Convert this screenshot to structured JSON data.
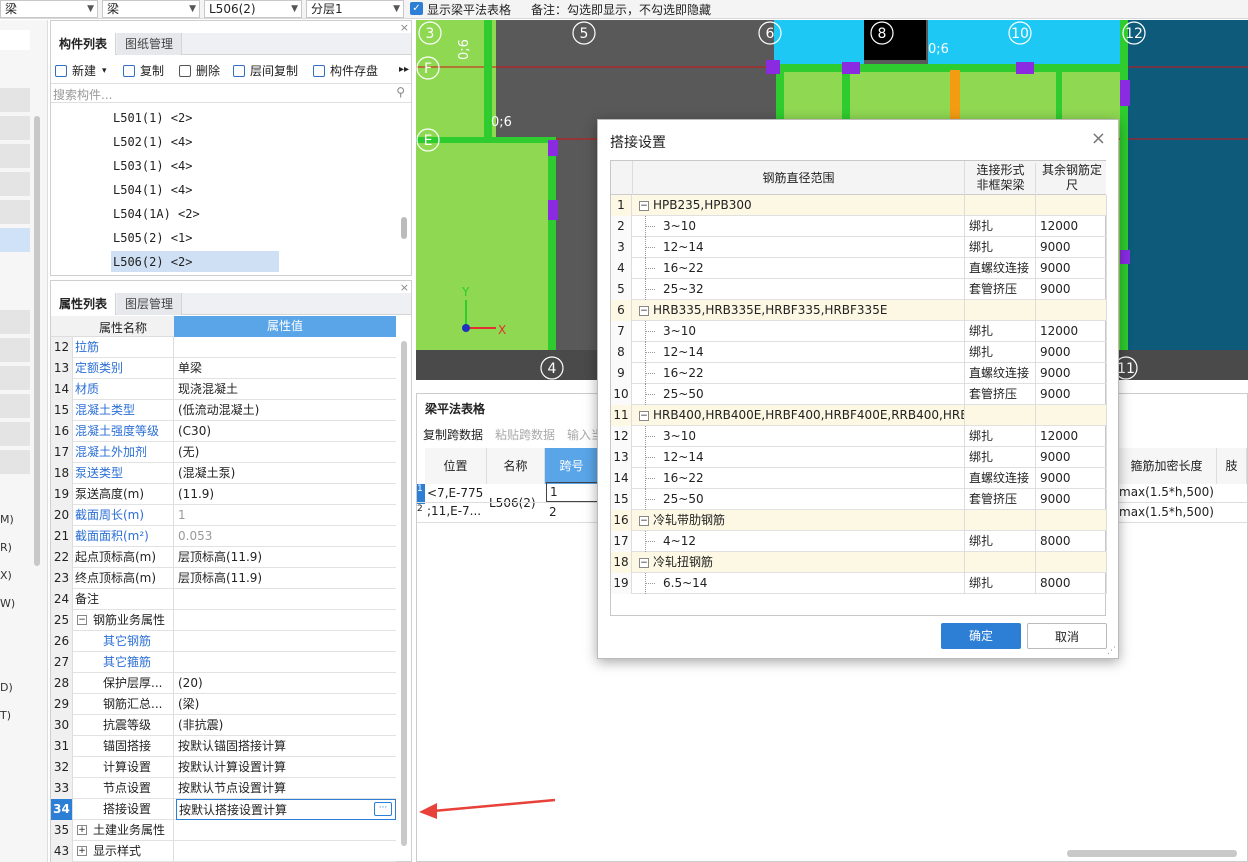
{
  "topbar": {
    "combo1": "梁",
    "combo2": "梁",
    "combo3": "L506(2)",
    "combo4": "分层1",
    "checkbox_label": "显示梁平法表格",
    "note": "备注：勾选即显示，不勾选即隐藏"
  },
  "left_strip": {
    "labels": [
      "M)",
      "R)",
      "X)",
      "W)",
      "D)",
      "T)"
    ]
  },
  "component_panel": {
    "tabs": [
      "构件列表",
      "图纸管理"
    ],
    "toolbar": [
      "新建",
      "复制",
      "删除",
      "层间复制",
      "构件存盘"
    ],
    "search_placeholder": "搜索构件...",
    "items": [
      "L501(1) <2>",
      "L502(1) <4>",
      "L503(1) <4>",
      "L504(1) <4>",
      "L504(1A) <2>",
      "L505(2) <1>",
      "L506(2) <2>"
    ],
    "selected_index": 6
  },
  "property_panel": {
    "tabs": [
      "属性列表",
      "图层管理"
    ],
    "headers": [
      "属性名称",
      "属性值"
    ],
    "rows": [
      {
        "num": "12",
        "name": "拉筋",
        "value": "",
        "style": "blue"
      },
      {
        "num": "13",
        "name": "定额类别",
        "value": "单梁",
        "style": "blue"
      },
      {
        "num": "14",
        "name": "材质",
        "value": "现浇混凝土",
        "style": "blue"
      },
      {
        "num": "15",
        "name": "混凝土类型",
        "value": "(低流动混凝土)",
        "style": "blue"
      },
      {
        "num": "16",
        "name": "混凝土强度等级",
        "value": "(C30)",
        "style": "blue"
      },
      {
        "num": "17",
        "name": "混凝土外加剂",
        "value": "(无)",
        "style": "blue"
      },
      {
        "num": "18",
        "name": "泵送类型",
        "value": "(混凝土泵)",
        "style": "blue"
      },
      {
        "num": "19",
        "name": "泵送高度(m)",
        "value": "(11.9)",
        "style": ""
      },
      {
        "num": "20",
        "name": "截面周长(m)",
        "value": "1",
        "style": "blue",
        "vstyle": "gray"
      },
      {
        "num": "21",
        "name": "截面面积(m²)",
        "value": "0.053",
        "style": "blue",
        "vstyle": "gray"
      },
      {
        "num": "22",
        "name": "起点顶标高(m)",
        "value": "层顶标高(11.9)",
        "style": ""
      },
      {
        "num": "23",
        "name": "终点顶标高(m)",
        "value": "层顶标高(11.9)",
        "style": ""
      },
      {
        "num": "24",
        "name": "备注",
        "value": "",
        "style": ""
      },
      {
        "num": "25",
        "name": "钢筋业务属性",
        "value": "",
        "style": "",
        "expand": "−"
      },
      {
        "num": "26",
        "name": "其它钢筋",
        "value": "",
        "style": "blue",
        "indent": true
      },
      {
        "num": "27",
        "name": "其它箍筋",
        "value": "",
        "style": "blue",
        "indent": true
      },
      {
        "num": "28",
        "name": "保护层厚...",
        "value": "(20)",
        "style": "",
        "indent": true
      },
      {
        "num": "29",
        "name": "钢筋汇总...",
        "value": "(梁)",
        "style": "",
        "indent": true
      },
      {
        "num": "30",
        "name": "抗震等级",
        "value": "(非抗震)",
        "style": "",
        "indent": true
      },
      {
        "num": "31",
        "name": "锚固搭接",
        "value": "按默认锚固搭接计算",
        "style": "",
        "indent": true
      },
      {
        "num": "32",
        "name": "计算设置",
        "value": "按默认计算设置计算",
        "style": "",
        "indent": true
      },
      {
        "num": "33",
        "name": "节点设置",
        "value": "按默认节点设置计算",
        "style": "",
        "indent": true
      },
      {
        "num": "34",
        "name": "搭接设置",
        "value": "按默认搭接设置计算",
        "style": "",
        "indent": true,
        "selected": true
      },
      {
        "num": "35",
        "name": "土建业务属性",
        "value": "",
        "style": "",
        "expand": "+"
      },
      {
        "num": "43",
        "name": "显示样式",
        "value": "",
        "style": "",
        "expand": "+"
      }
    ],
    "ellipsis": "···"
  },
  "canvas": {
    "grid_labels": [
      "3",
      "5",
      "6",
      "8",
      "10",
      "12"
    ],
    "row_labels": [
      "F",
      "E"
    ],
    "dims": [
      "0;6",
      "0;6",
      "0;6"
    ],
    "axis_x": "X",
    "axis_y": "Y",
    "bottom_labels": [
      "4",
      "11"
    ]
  },
  "dialog": {
    "title": "搭接设置",
    "close": "×",
    "col_range": "钢筋直径范围",
    "col_type_line1": "连接形式",
    "col_type_line2": "非框架梁",
    "col_len_line1": "其余钢筋定",
    "col_len_line2": "尺",
    "rows": [
      {
        "n": "1",
        "range": "HPB235,HPB300",
        "type": "",
        "len": "",
        "group": true
      },
      {
        "n": "2",
        "range": "3~10",
        "type": "绑扎",
        "len": "12000"
      },
      {
        "n": "3",
        "range": "12~14",
        "type": "绑扎",
        "len": "9000"
      },
      {
        "n": "4",
        "range": "16~22",
        "type": "直螺纹连接",
        "len": "9000"
      },
      {
        "n": "5",
        "range": "25~32",
        "type": "套管挤压",
        "len": "9000"
      },
      {
        "n": "6",
        "range": "HRB335,HRB335E,HRBF335,HRBF335E",
        "type": "",
        "len": "",
        "group": true
      },
      {
        "n": "7",
        "range": "3~10",
        "type": "绑扎",
        "len": "12000"
      },
      {
        "n": "8",
        "range": "12~14",
        "type": "绑扎",
        "len": "9000"
      },
      {
        "n": "9",
        "range": "16~22",
        "type": "直螺纹连接",
        "len": "9000"
      },
      {
        "n": "10",
        "range": "25~50",
        "type": "套管挤压",
        "len": "9000"
      },
      {
        "n": "11",
        "range": "HRB400,HRB400E,HRBF400,HRBF400E,RRB400,HRB...",
        "type": "",
        "len": "",
        "group": true
      },
      {
        "n": "12",
        "range": "3~10",
        "type": "绑扎",
        "len": "12000"
      },
      {
        "n": "13",
        "range": "12~14",
        "type": "绑扎",
        "len": "9000"
      },
      {
        "n": "14",
        "range": "16~22",
        "type": "直螺纹连接",
        "len": "9000"
      },
      {
        "n": "15",
        "range": "25~50",
        "type": "套管挤压",
        "len": "9000"
      },
      {
        "n": "16",
        "range": "冷轧带肋钢筋",
        "type": "",
        "len": "",
        "group": true
      },
      {
        "n": "17",
        "range": "4~12",
        "type": "绑扎",
        "len": "8000"
      },
      {
        "n": "18",
        "range": "冷轧扭钢筋",
        "type": "",
        "len": "",
        "group": true
      },
      {
        "n": "19",
        "range": "6.5~14",
        "type": "绑扎",
        "len": "8000"
      }
    ],
    "ok": "确定",
    "cancel": "取消"
  },
  "beam_table": {
    "title": "梁平法表格",
    "toolbar": [
      "复制跨数据",
      "粘贴跨数据",
      "输入当"
    ],
    "headers": [
      "位置",
      "名称",
      "跨号",
      "箍筋加密长度",
      "肢"
    ],
    "row1": {
      "pos": "<7,E-775",
      "span": "1",
      "dense": "max(1.5*h,500)"
    },
    "row2": {
      "pos": ";11,E-7...",
      "span": "2",
      "dense": "max(1.5*h,500)"
    },
    "name": "L506(2)",
    "row_nums": [
      "1",
      "2"
    ]
  },
  "colors": {
    "accent": "#2d7fd6",
    "canvas_green": "#8fd852",
    "canvas_dark": "#595959",
    "canvas_blue": "#0d5a7a",
    "beam_green": "#2ecc2e",
    "purple": "#8a2be2",
    "red_arrow": "#e8413a"
  }
}
